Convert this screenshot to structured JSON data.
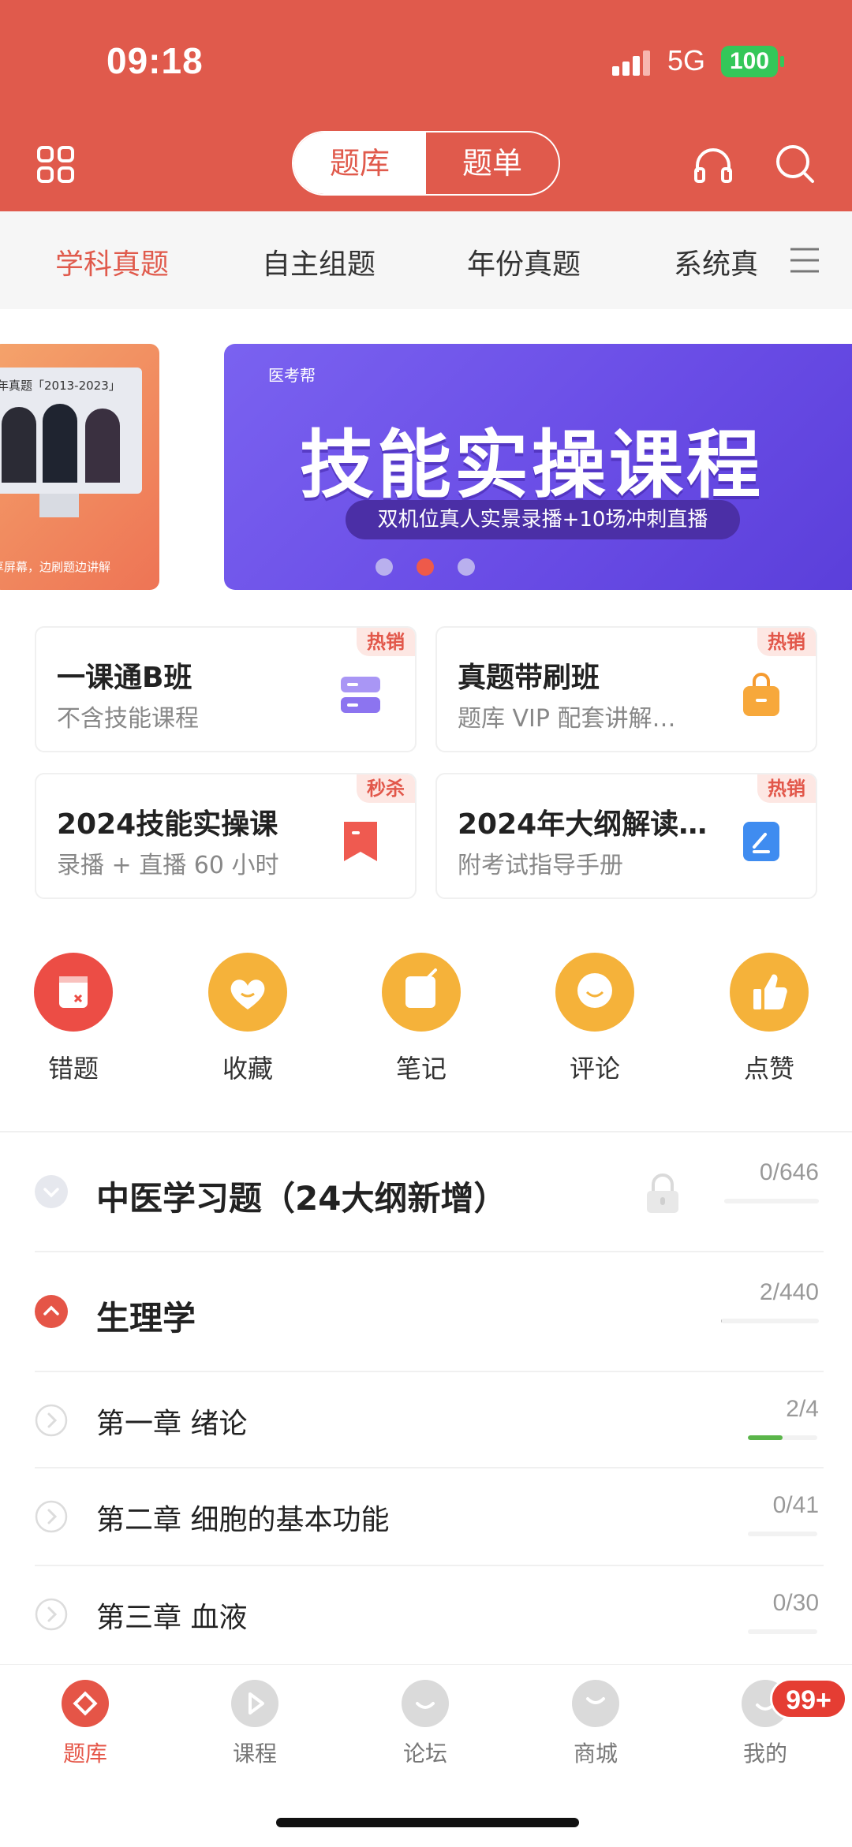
{
  "status": {
    "time": "09:18",
    "network": "5G",
    "battery": "100"
  },
  "header": {
    "seg_left": "题库",
    "seg_right": "题单"
  },
  "tabs": [
    "学科真题",
    "自主组题",
    "年份真题",
    "系统真"
  ],
  "banner_left": {
    "text": "年真题「2013-2023」",
    "caption": "享屏幕，边刷题边讲解"
  },
  "banner": {
    "brand": "医考帮",
    "title": "技能实操课程",
    "subtitle": "双机位真人实景录播+10场冲刺直播"
  },
  "cards": [
    {
      "title": "一课通B班",
      "sub": "不含技能课程",
      "tag": "热销"
    },
    {
      "title": "真题带刷班",
      "sub": "题库 VIP 配套讲解…",
      "tag": "热销"
    },
    {
      "title": "2024技能实操课",
      "sub": "录播 + 直播 60 小时",
      "tag": "秒杀"
    },
    {
      "title": "2024年大纲解读…",
      "sub": "附考试指导手册",
      "tag": "热销"
    }
  ],
  "quick": [
    "错题",
    "收藏",
    "笔记",
    "评论",
    "点赞"
  ],
  "list": [
    {
      "title": "中医学习题（24大纲新增）",
      "count": "0/646",
      "progress": 0
    },
    {
      "title": "生理学",
      "count": "2/440",
      "progress": 0.0045
    },
    {
      "title": "第一章 绪论",
      "count": "2/4",
      "progress": 0.5
    },
    {
      "title": "第二章 细胞的基本功能",
      "count": "0/41",
      "progress": 0
    },
    {
      "title": "第三章 血液",
      "count": "0/30",
      "progress": 0
    }
  ],
  "nav": [
    "题库",
    "课程",
    "论坛",
    "商城",
    "我的"
  ],
  "badge": "99+",
  "colors": {
    "brand": "#e05a4c",
    "accent_orange": "#f5b23a",
    "progress": "#5ab54a"
  }
}
